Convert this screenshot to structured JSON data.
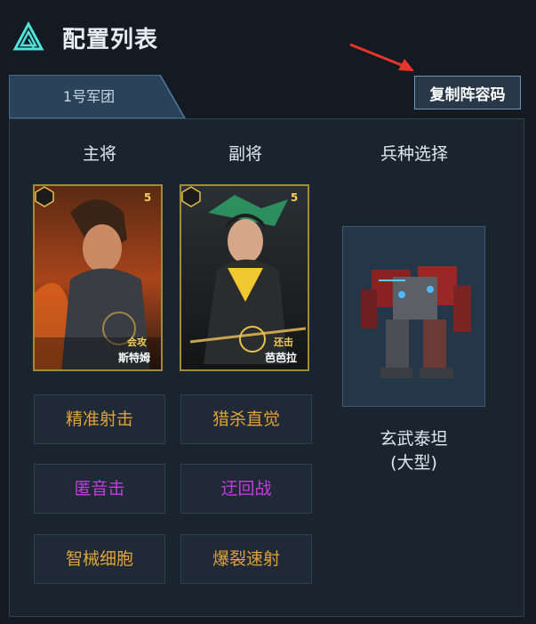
{
  "header": {
    "title": "配置列表",
    "copy_button": "复制阵容码"
  },
  "tabs": [
    {
      "label": "1号军团",
      "active": true
    }
  ],
  "columns": {
    "main": "主将",
    "deputy": "副将",
    "troop": "兵种选择"
  },
  "main_general": {
    "name": "斯特姆",
    "role": "会攻",
    "stars": "5"
  },
  "deputy_general": {
    "name": "芭芭拉",
    "role": "还击",
    "stars": "5"
  },
  "main_skills": [
    {
      "label": "精准射击",
      "color": "#e0a23a"
    },
    {
      "label": "匿音击",
      "color": "#c43be0"
    },
    {
      "label": "智械细胞",
      "color": "#e0a23a"
    }
  ],
  "deputy_skills": [
    {
      "label": "猎杀直觉",
      "color": "#e0a23a"
    },
    {
      "label": "迂回战",
      "color": "#c43be0"
    },
    {
      "label": "爆裂速射",
      "color": "#e0a23a"
    }
  ],
  "troop": {
    "name": "玄武泰坦",
    "size": "(大型)"
  },
  "colors": {
    "accent_gold": "#e0a23a",
    "accent_purple": "#c43be0",
    "arrow_red": "#e8352a"
  }
}
